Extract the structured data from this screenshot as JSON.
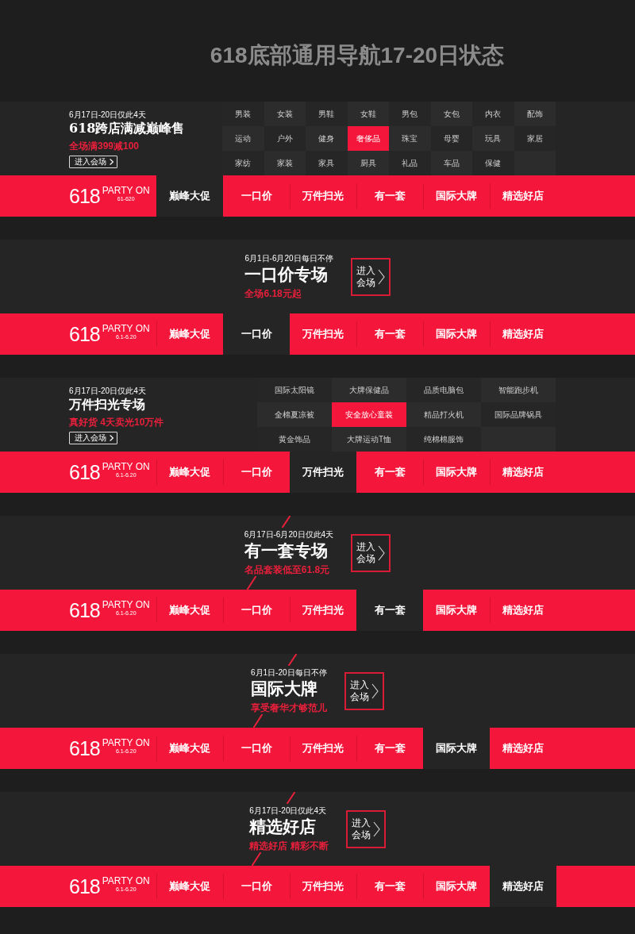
{
  "title": "618底部通用导航17-20日状态",
  "sections": [
    {
      "kind": "grid",
      "promo": {
        "date": "6月17日-20日仅此4天",
        "headline": "618跨店满减巅峰售",
        "offer": "全场满399减100",
        "button": "进入会场"
      },
      "grid_rows": [
        [
          {
            "label": "男装",
            "selected": false
          },
          {
            "label": "女装",
            "selected": false
          },
          {
            "label": "男鞋",
            "selected": false
          },
          {
            "label": "女鞋",
            "selected": false
          },
          {
            "label": "男包",
            "selected": false
          },
          {
            "label": "女包",
            "selected": false
          },
          {
            "label": "内衣",
            "selected": false
          },
          {
            "label": "配饰",
            "selected": false
          }
        ],
        [
          {
            "label": "运动",
            "selected": false
          },
          {
            "label": "户外",
            "selected": false
          },
          {
            "label": "健身",
            "selected": false
          },
          {
            "label": "奢侈品",
            "selected": true
          },
          {
            "label": "珠宝",
            "selected": false
          },
          {
            "label": "母婴",
            "selected": false
          },
          {
            "label": "玩具",
            "selected": false
          },
          {
            "label": "家居",
            "selected": false
          }
        ],
        [
          {
            "label": "家纺",
            "selected": false
          },
          {
            "label": "家装",
            "selected": false
          },
          {
            "label": "家具",
            "selected": false
          },
          {
            "label": "厨具",
            "selected": false
          },
          {
            "label": "礼品",
            "selected": false
          },
          {
            "label": "车品",
            "selected": false
          },
          {
            "label": "保健",
            "selected": false
          }
        ]
      ],
      "nav": {
        "logo": {
          "number": "618",
          "slogan": "PARTY ON",
          "dates": "61-620"
        },
        "tabs": [
          {
            "label": "巅峰大促",
            "selected": true
          },
          {
            "label": "一口价",
            "selected": false
          },
          {
            "label": "万件扫光",
            "selected": false
          },
          {
            "label": "有一套",
            "selected": false
          },
          {
            "label": "国际大牌",
            "selected": false
          },
          {
            "label": "精选好店",
            "selected": false
          }
        ]
      }
    },
    {
      "kind": "feature",
      "promo": {
        "date": "6月1日-6月20日每日不停",
        "headline": "一口价专场",
        "offer": "全场6.18元起",
        "button": "进入会场",
        "slashes": false
      },
      "nav": {
        "logo": {
          "number": "618",
          "slogan": "PARTY ON",
          "dates": "6.1-6.20"
        },
        "tabs": [
          {
            "label": "巅峰大促",
            "selected": false
          },
          {
            "label": "一口价",
            "selected": true
          },
          {
            "label": "万件扫光",
            "selected": false
          },
          {
            "label": "有一套",
            "selected": false
          },
          {
            "label": "国际大牌",
            "selected": false
          },
          {
            "label": "精选好店",
            "selected": false
          }
        ]
      }
    },
    {
      "kind": "grid",
      "promo": {
        "date": "6月17日-20日仅此4天",
        "headline": "万件扫光专场",
        "offer": "真好货 4天卖光10万件",
        "button": "进入会场"
      },
      "grid_rows": [
        [
          {
            "label": "国际太阳镜",
            "selected": false
          },
          {
            "label": "大牌保健品",
            "selected": false
          },
          {
            "label": "品质电脑包",
            "selected": false
          },
          {
            "label": "智能跑步机",
            "selected": false
          }
        ],
        [
          {
            "label": "全棉夏凉被",
            "selected": false
          },
          {
            "label": "安全放心童装",
            "selected": true
          },
          {
            "label": "精品打火机",
            "selected": false
          },
          {
            "label": "国际品牌锅具",
            "selected": false
          }
        ],
        [
          {
            "label": "黄金饰品",
            "selected": false
          },
          {
            "label": "大牌运动T恤",
            "selected": false
          },
          {
            "label": "纯棉棉服饰",
            "selected": false
          }
        ]
      ],
      "nav": {
        "logo": {
          "number": "618",
          "slogan": "PARTY ON",
          "dates": "6.1-6.20"
        },
        "tabs": [
          {
            "label": "巅峰大促",
            "selected": false
          },
          {
            "label": "一口价",
            "selected": false
          },
          {
            "label": "万件扫光",
            "selected": true
          },
          {
            "label": "有一套",
            "selected": false
          },
          {
            "label": "国际大牌",
            "selected": false
          },
          {
            "label": "精选好店",
            "selected": false
          }
        ]
      }
    },
    {
      "kind": "feature",
      "promo": {
        "date": "6月17日-6月20日仅此4天",
        "headline": "有一套专场",
        "offer": "名品套装低至61.8元",
        "button": "进入会场",
        "slashes": true
      },
      "nav": {
        "logo": {
          "number": "618",
          "slogan": "PARTY ON",
          "dates": "6.1-6.20"
        },
        "tabs": [
          {
            "label": "巅峰大促",
            "selected": false
          },
          {
            "label": "一口价",
            "selected": false
          },
          {
            "label": "万件扫光",
            "selected": false
          },
          {
            "label": "有一套",
            "selected": true
          },
          {
            "label": "国际大牌",
            "selected": false
          },
          {
            "label": "精选好店",
            "selected": false
          }
        ]
      }
    },
    {
      "kind": "feature",
      "promo": {
        "date": "6月1日-20日每日不停",
        "headline": "国际大牌",
        "offer": "享受奢华才够范儿",
        "button": "进入会场",
        "slashes": true
      },
      "nav": {
        "logo": {
          "number": "618",
          "slogan": "PARTY ON",
          "dates": "6.1-6.20"
        },
        "tabs": [
          {
            "label": "巅峰大促",
            "selected": false
          },
          {
            "label": "一口价",
            "selected": false
          },
          {
            "label": "万件扫光",
            "selected": false
          },
          {
            "label": "有一套",
            "selected": false
          },
          {
            "label": "国际大牌",
            "selected": true
          },
          {
            "label": "精选好店",
            "selected": false
          }
        ]
      }
    },
    {
      "kind": "feature",
      "promo": {
        "date": "6月17日-20日仅此4天",
        "headline": "精选好店",
        "offer": "精选好店 精彩不断",
        "button": "进入会场",
        "slashes": true
      },
      "nav": {
        "logo": {
          "number": "618",
          "slogan": "PARTY ON",
          "dates": "6.1-6.20"
        },
        "tabs": [
          {
            "label": "巅峰大促",
            "selected": false
          },
          {
            "label": "一口价",
            "selected": false
          },
          {
            "label": "万件扫光",
            "selected": false
          },
          {
            "label": "有一套",
            "selected": false
          },
          {
            "label": "国际大牌",
            "selected": false
          },
          {
            "label": "精选好店",
            "selected": true
          }
        ]
      }
    }
  ]
}
